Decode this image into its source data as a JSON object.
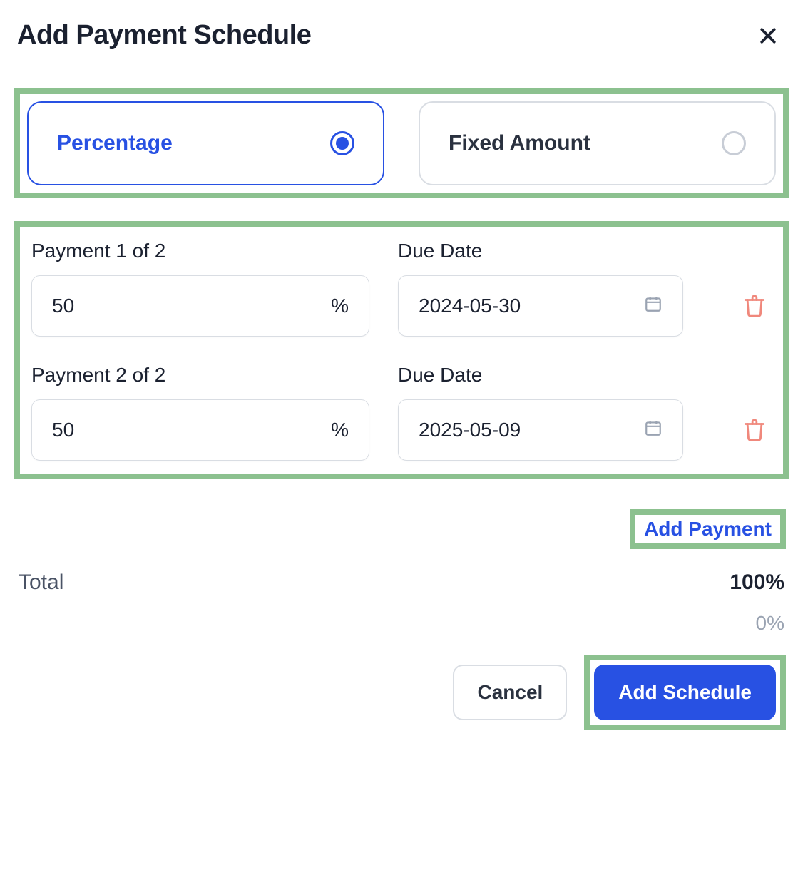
{
  "header": {
    "title": "Add Payment Schedule"
  },
  "type_options": {
    "percentage": "Percentage",
    "fixed": "Fixed Amount",
    "selected": "percentage"
  },
  "payments": [
    {
      "label": "Payment 1 of 2",
      "due_label": "Due Date",
      "value": "50",
      "suffix": "%",
      "date": "2024-05-30"
    },
    {
      "label": "Payment 2 of 2",
      "due_label": "Due Date",
      "value": "50",
      "suffix": "%",
      "date": "2025-05-09"
    }
  ],
  "add_payment_label": "Add Payment",
  "total": {
    "label": "Total",
    "value": "100%",
    "sub_value": "0%"
  },
  "footer": {
    "cancel": "Cancel",
    "submit": "Add Schedule"
  }
}
